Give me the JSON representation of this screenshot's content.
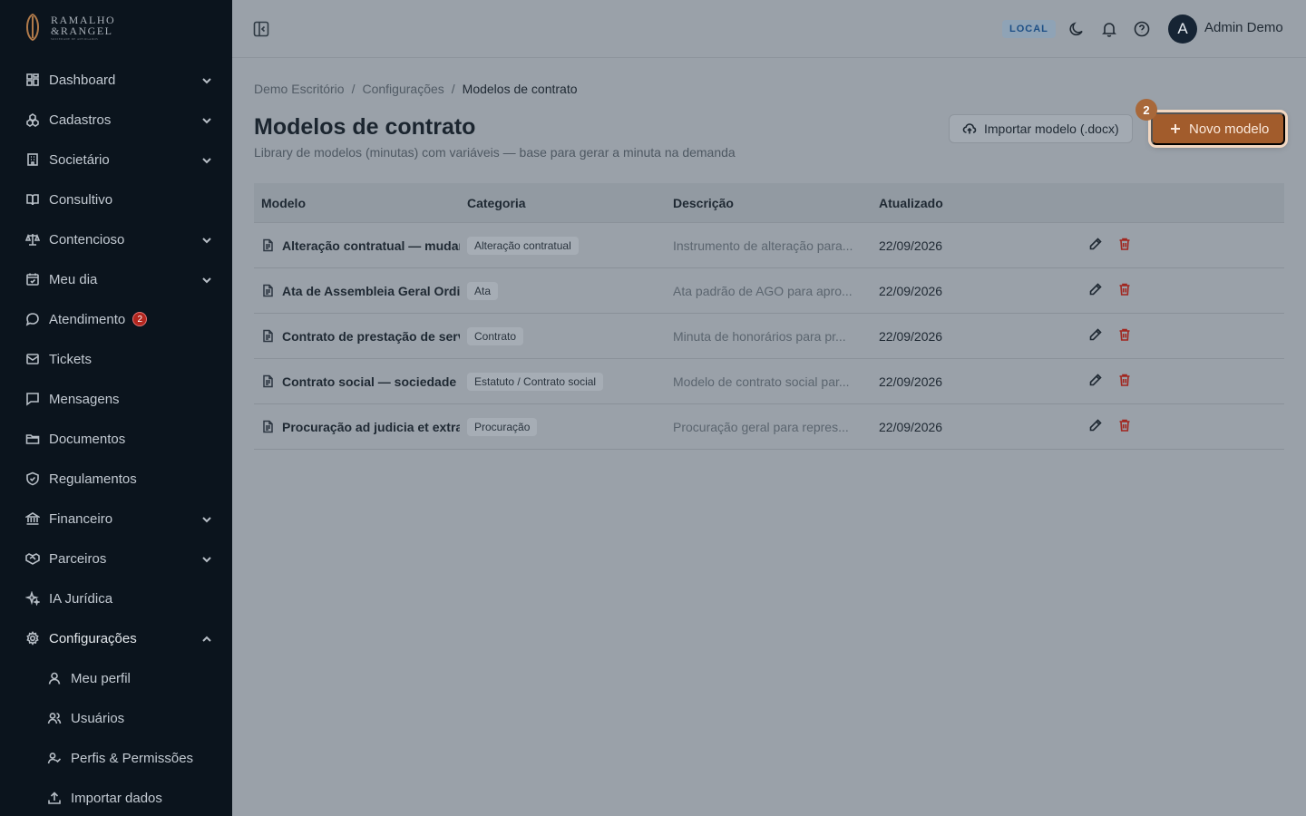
{
  "brand": {
    "line1": "RAMALHO",
    "line2": "&RANGEL",
    "line3": "SOCIEDADE DE ADVOGADOS"
  },
  "sidebar": {
    "items": [
      {
        "label": "Dashboard",
        "icon": "dashboard-icon",
        "expandable": true
      },
      {
        "label": "Cadastros",
        "icon": "cubes-icon",
        "expandable": true
      },
      {
        "label": "Societário",
        "icon": "building-icon",
        "expandable": true
      },
      {
        "label": "Consultivo",
        "icon": "book-icon",
        "expandable": false
      },
      {
        "label": "Contencioso",
        "icon": "scale-icon",
        "expandable": true
      },
      {
        "label": "Meu dia",
        "icon": "calendar-icon",
        "expandable": true
      },
      {
        "label": "Atendimento",
        "icon": "chat-icon",
        "badge": "2"
      },
      {
        "label": "Tickets",
        "icon": "ticket-icon"
      },
      {
        "label": "Mensagens",
        "icon": "message-icon"
      },
      {
        "label": "Documentos",
        "icon": "folder-icon"
      },
      {
        "label": "Regulamentos",
        "icon": "shield-icon"
      },
      {
        "label": "Financeiro",
        "icon": "bank-icon",
        "expandable": true
      },
      {
        "label": "Parceiros",
        "icon": "handshake-icon",
        "expandable": true
      },
      {
        "label": "IA Jurídica",
        "icon": "sparkles-icon"
      },
      {
        "label": "Configurações",
        "icon": "gear-icon",
        "expanded": true
      }
    ],
    "subitems": [
      {
        "label": "Meu perfil",
        "icon": "user-icon"
      },
      {
        "label": "Usuários",
        "icon": "users-icon"
      },
      {
        "label": "Perfis & Permissões",
        "icon": "user-check-icon"
      },
      {
        "label": "Importar dados",
        "icon": "upload-icon"
      }
    ]
  },
  "header": {
    "env": "LOCAL",
    "avatar_initial": "A",
    "user_name": "Admin Demo"
  },
  "breadcrumb": {
    "items": [
      "Demo Escritório",
      "Configurações"
    ],
    "separator": "/",
    "current": "Modelos de contrato"
  },
  "page": {
    "title": "Modelos de contrato",
    "subtitle": "Library de modelos (minutas) com variáveis — base para gerar a minuta na demanda",
    "import_label": "Importar modelo (.docx)",
    "new_label": "Novo modelo",
    "step_badge": "2"
  },
  "table": {
    "columns": [
      "Modelo",
      "Categoria",
      "Descrição",
      "Atualizado"
    ],
    "rows": [
      {
        "modelo": "Alteração contratual — mudança",
        "categoria": "Alteração contratual",
        "descricao": "Instrumento de alteração para...",
        "atualizado": "22/09/2026"
      },
      {
        "modelo": "Ata de Assembleia Geral Ordinária",
        "categoria": "Ata",
        "descricao": "Ata padrão de AGO para apro...",
        "atualizado": "22/09/2026"
      },
      {
        "modelo": "Contrato de prestação de serviços",
        "categoria": "Contrato",
        "descricao": "Minuta de honorários para pr...",
        "atualizado": "22/09/2026"
      },
      {
        "modelo": "Contrato social — sociedade",
        "categoria": "Estatuto / Contrato social",
        "descricao": "Modelo de contrato social par...",
        "atualizado": "22/09/2026"
      },
      {
        "modelo": "Procuração ad judicia et extra",
        "categoria": "Procuração",
        "descricao": "Procuração geral para repres...",
        "atualizado": "22/09/2026"
      }
    ]
  },
  "colors": {
    "sidebar_bg": "#0b141d",
    "accent": "#a25c2c",
    "danger": "#a1261f"
  }
}
